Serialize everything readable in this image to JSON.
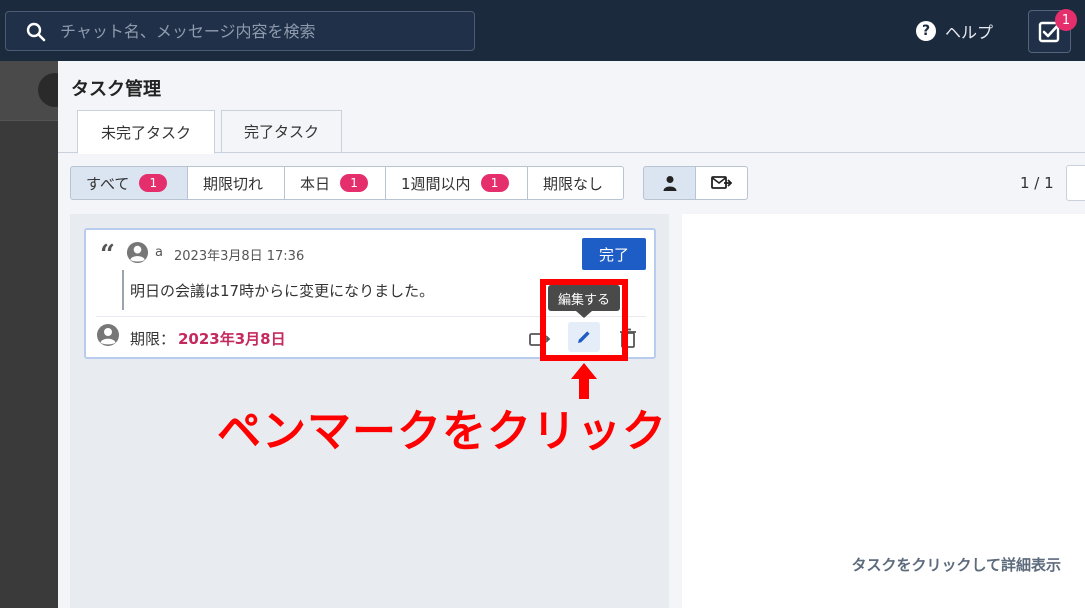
{
  "topbar": {
    "search_placeholder": "チャット名、メッセージ内容を検索",
    "help_label": "ヘルプ",
    "task_badge": "1"
  },
  "panel": {
    "title": "タスク管理",
    "tabs": [
      {
        "label": "未完了タスク",
        "active": true
      },
      {
        "label": "完了タスク",
        "active": false
      }
    ],
    "filters": [
      {
        "label": "すべて",
        "count": "1",
        "selected": true
      },
      {
        "label": "期限切れ",
        "count": null,
        "selected": false
      },
      {
        "label": "本日",
        "count": "1",
        "selected": false
      },
      {
        "label": "1週間以内",
        "count": "1",
        "selected": false
      },
      {
        "label": "期限なし",
        "count": null,
        "selected": false
      }
    ],
    "view_buttons": [
      "my-tasks-icon",
      "assigned-tasks-icon"
    ],
    "pager": "1 / 1",
    "detail_hint": "タスクをクリックして詳細表示"
  },
  "task": {
    "author": "a",
    "date": "2023年3月8日 17:36",
    "done_label": "完了",
    "message": "明日の会議は17時からに変更になりました。",
    "deadline_label": "期限：",
    "deadline_value": "2023年3月8日",
    "edit_tooltip": "編集する"
  },
  "annotation": {
    "callout": "ペンマークをクリック",
    "color": "#ff0000"
  },
  "colors": {
    "topbar": "#1c2a3e",
    "accent": "#1e5cc6",
    "badge": "#e52e6c",
    "deadline": "#c52a5f"
  }
}
